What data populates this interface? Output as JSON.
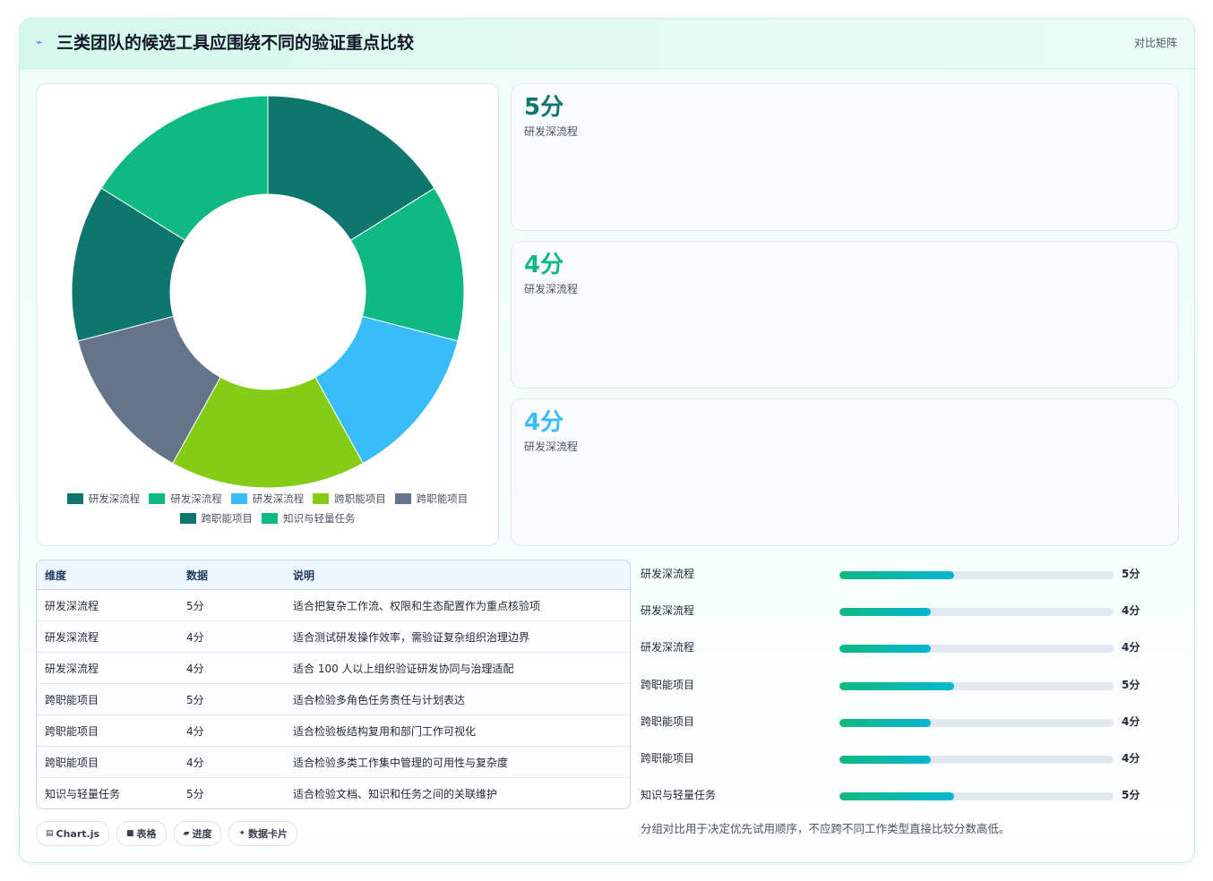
{
  "header": {
    "icon": "sparkle-icon",
    "title": "三类团队的候选工具应围绕不同的验证重点比较",
    "action": "对比矩阵"
  },
  "chart_data": {
    "type": "pie",
    "donut": true,
    "legend_position": "bottom",
    "categories": [
      "研发深流程",
      "研发深流程",
      "研发深流程",
      "跨职能项目",
      "跨职能项目",
      "跨职能项目",
      "知识与轻量任务"
    ],
    "values": [
      5,
      4,
      4,
      5,
      4,
      4,
      5
    ],
    "colors": [
      "#0f766e",
      "#10b981",
      "#38bdf8",
      "#84cc16",
      "#64748b",
      "#0f766e",
      "#10b981"
    ]
  },
  "stat_cards": [
    {
      "value": "5分",
      "label": "研发深流程",
      "color": "#0f766e"
    },
    {
      "value": "4分",
      "label": "研发深流程",
      "color": "#10b981"
    },
    {
      "value": "4分",
      "label": "研发深流程",
      "color": "#38bdf8"
    }
  ],
  "table": {
    "headers": [
      "维度",
      "数据",
      "说明"
    ],
    "rows": [
      [
        "研发深流程",
        "5分",
        "适合把复杂工作流、权限和生态配置作为重点核验项"
      ],
      [
        "研发深流程",
        "4分",
        "适合测试研发操作效率，需验证复杂组织治理边界"
      ],
      [
        "研发深流程",
        "4分",
        "适合 100 人以上组织验证研发协同与治理适配"
      ],
      [
        "跨职能项目",
        "5分",
        "适合检验多角色任务责任与计划表达"
      ],
      [
        "跨职能项目",
        "4分",
        "适合检验板结构复用和部门工作可视化"
      ],
      [
        "跨职能项目",
        "4分",
        "适合检验多类工作集中管理的可用性与复杂度"
      ],
      [
        "知识与轻量任务",
        "5分",
        "适合检验文档、知识和任务之间的关联维护"
      ]
    ]
  },
  "progress": {
    "max": 12,
    "items": [
      {
        "label": "研发深流程",
        "value": 5,
        "text": "5分"
      },
      {
        "label": "研发深流程",
        "value": 4,
        "text": "4分"
      },
      {
        "label": "研发深流程",
        "value": 4,
        "text": "4分"
      },
      {
        "label": "跨职能项目",
        "value": 5,
        "text": "5分"
      },
      {
        "label": "跨职能项目",
        "value": 4,
        "text": "4分"
      },
      {
        "label": "跨职能项目",
        "value": 4,
        "text": "4分"
      },
      {
        "label": "知识与轻量任务",
        "value": 5,
        "text": "5分"
      }
    ]
  },
  "note": "分组对比用于决定优先试用顺序，不应跨不同工作类型直接比较分数高低。",
  "tags": [
    {
      "icon": "chart-icon",
      "glyph": "▤",
      "label": "Chart.js"
    },
    {
      "icon": "table-icon",
      "glyph": "■",
      "label": "表格"
    },
    {
      "icon": "progress-icon",
      "glyph": "▰",
      "label": "进度"
    },
    {
      "icon": "card-icon",
      "glyph": "✦",
      "label": "数据卡片"
    }
  ]
}
